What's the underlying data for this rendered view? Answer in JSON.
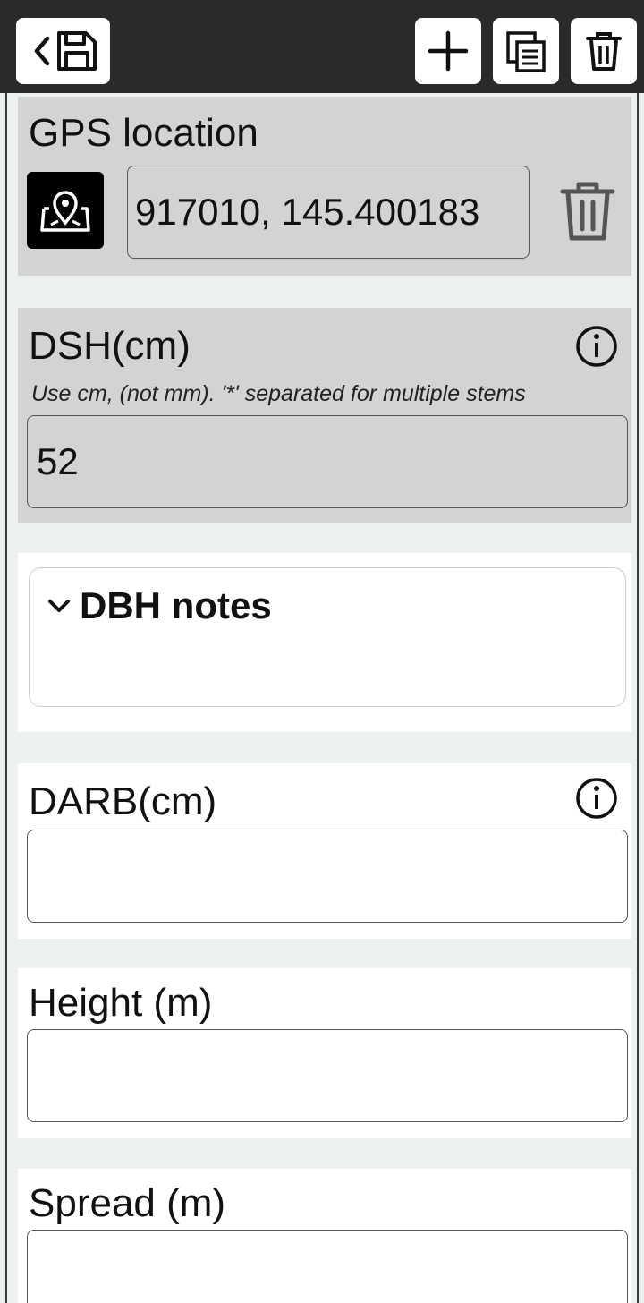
{
  "toolbar": {
    "back_icon": "chevron-left-icon",
    "save_icon": "floppy-disk-icon",
    "add_icon": "plus-icon",
    "copy_icon": "copy-record-icon",
    "delete_icon": "trash-icon"
  },
  "gps": {
    "label": "GPS location",
    "value": "917010, 145.400183",
    "map_icon": "map-pin-icon",
    "clear_icon": "trash-icon"
  },
  "dsh": {
    "label": "DSH(cm)",
    "hint": "Use cm, (not mm). '*' separated for multiple stems",
    "value": "52",
    "info_icon": "info-icon"
  },
  "dbh_notes": {
    "label": "DBH notes",
    "expand_icon": "chevron-down-icon"
  },
  "darb": {
    "label": "DARB(cm)",
    "value": "",
    "info_icon": "info-icon"
  },
  "height": {
    "label": "Height (m)",
    "value": ""
  },
  "spread": {
    "label": "Spread (m)",
    "value": ""
  },
  "colors": {
    "topbar": "#2b2a2a",
    "card_grey": "#d3d3d3",
    "card_white": "#ffffff",
    "background": "#ecf0f1"
  }
}
